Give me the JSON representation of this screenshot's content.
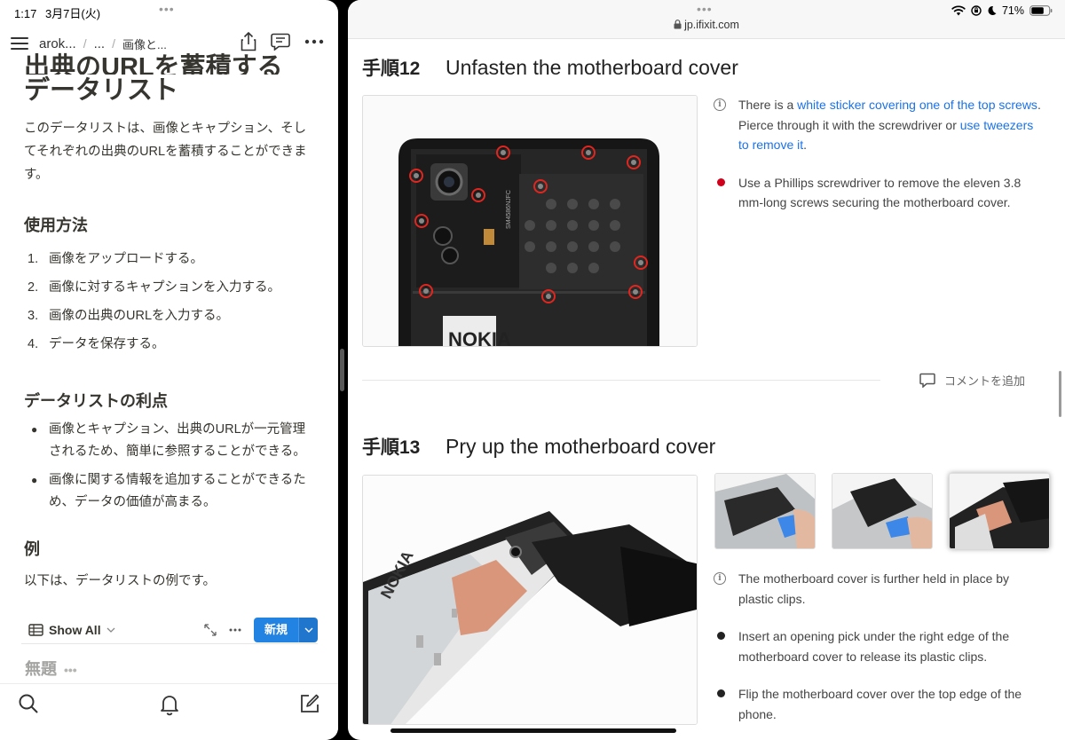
{
  "notion": {
    "status": {
      "time": "1:17",
      "date": "3月7日(火)"
    },
    "breadcrumb": [
      "arok...",
      "...",
      "画像と..."
    ],
    "title_partial": "出典のURLを蓄積する",
    "title_line2": "データリスト",
    "intro": "このデータリストは、画像とキャプション、そしてそれぞれの出典のURLを蓄積することができます。",
    "usage_heading": "使用方法",
    "usage_steps": [
      {
        "n": "1.",
        "text": "画像をアップロードする。"
      },
      {
        "n": "2.",
        "text": "画像に対するキャプションを入力する。"
      },
      {
        "n": "3.",
        "text": "画像の出典のURLを入力する。"
      },
      {
        "n": "4.",
        "text": "データを保存する。"
      }
    ],
    "benefits_heading": "データリストの利点",
    "benefits": [
      "画像とキャプション、出典のURLが一元管理されるため、簡単に参照することができる。",
      "画像に関する情報を追加することができるため、データの価値が高まる。"
    ],
    "example_heading": "例",
    "example_text": "以下は、データリストの例です。",
    "db": {
      "view_label": "Show All",
      "new_label": "新規"
    },
    "untitled": "無題"
  },
  "ifixit": {
    "url": "jp.ifixit.com",
    "battery": "71%",
    "step12": {
      "number": "手順12",
      "title": "Unfasten the motherboard cover",
      "b1_pre": "There is a ",
      "b1_link1": "white sticker covering one of the top screws",
      "b1_mid": ". Pierce through it with the screwdriver or ",
      "b1_link2": "use tweezers to remove it",
      "b1_post": ".",
      "b2": "Use a Phillips screwdriver to remove the eleven 3.8 mm-long screws securing the motherboard cover."
    },
    "comment": "コメントを追加",
    "step13": {
      "number": "手順13",
      "title": "Pry up the motherboard cover",
      "b1": "The motherboard cover is further held in place by plastic clips.",
      "b2": "Insert an opening pick under the right edge of the motherboard cover to release its plastic clips.",
      "b3": "Flip the motherboard cover over the top edge of the phone."
    },
    "photo_text": {
      "nokia": "NOKIA",
      "shield_label": "SM4586NJFC"
    },
    "colors": {
      "link": "#1a73e8",
      "red_bullet": "#d0021b",
      "black_bullet": "#222222",
      "notion_blue": "#2383e2"
    }
  }
}
